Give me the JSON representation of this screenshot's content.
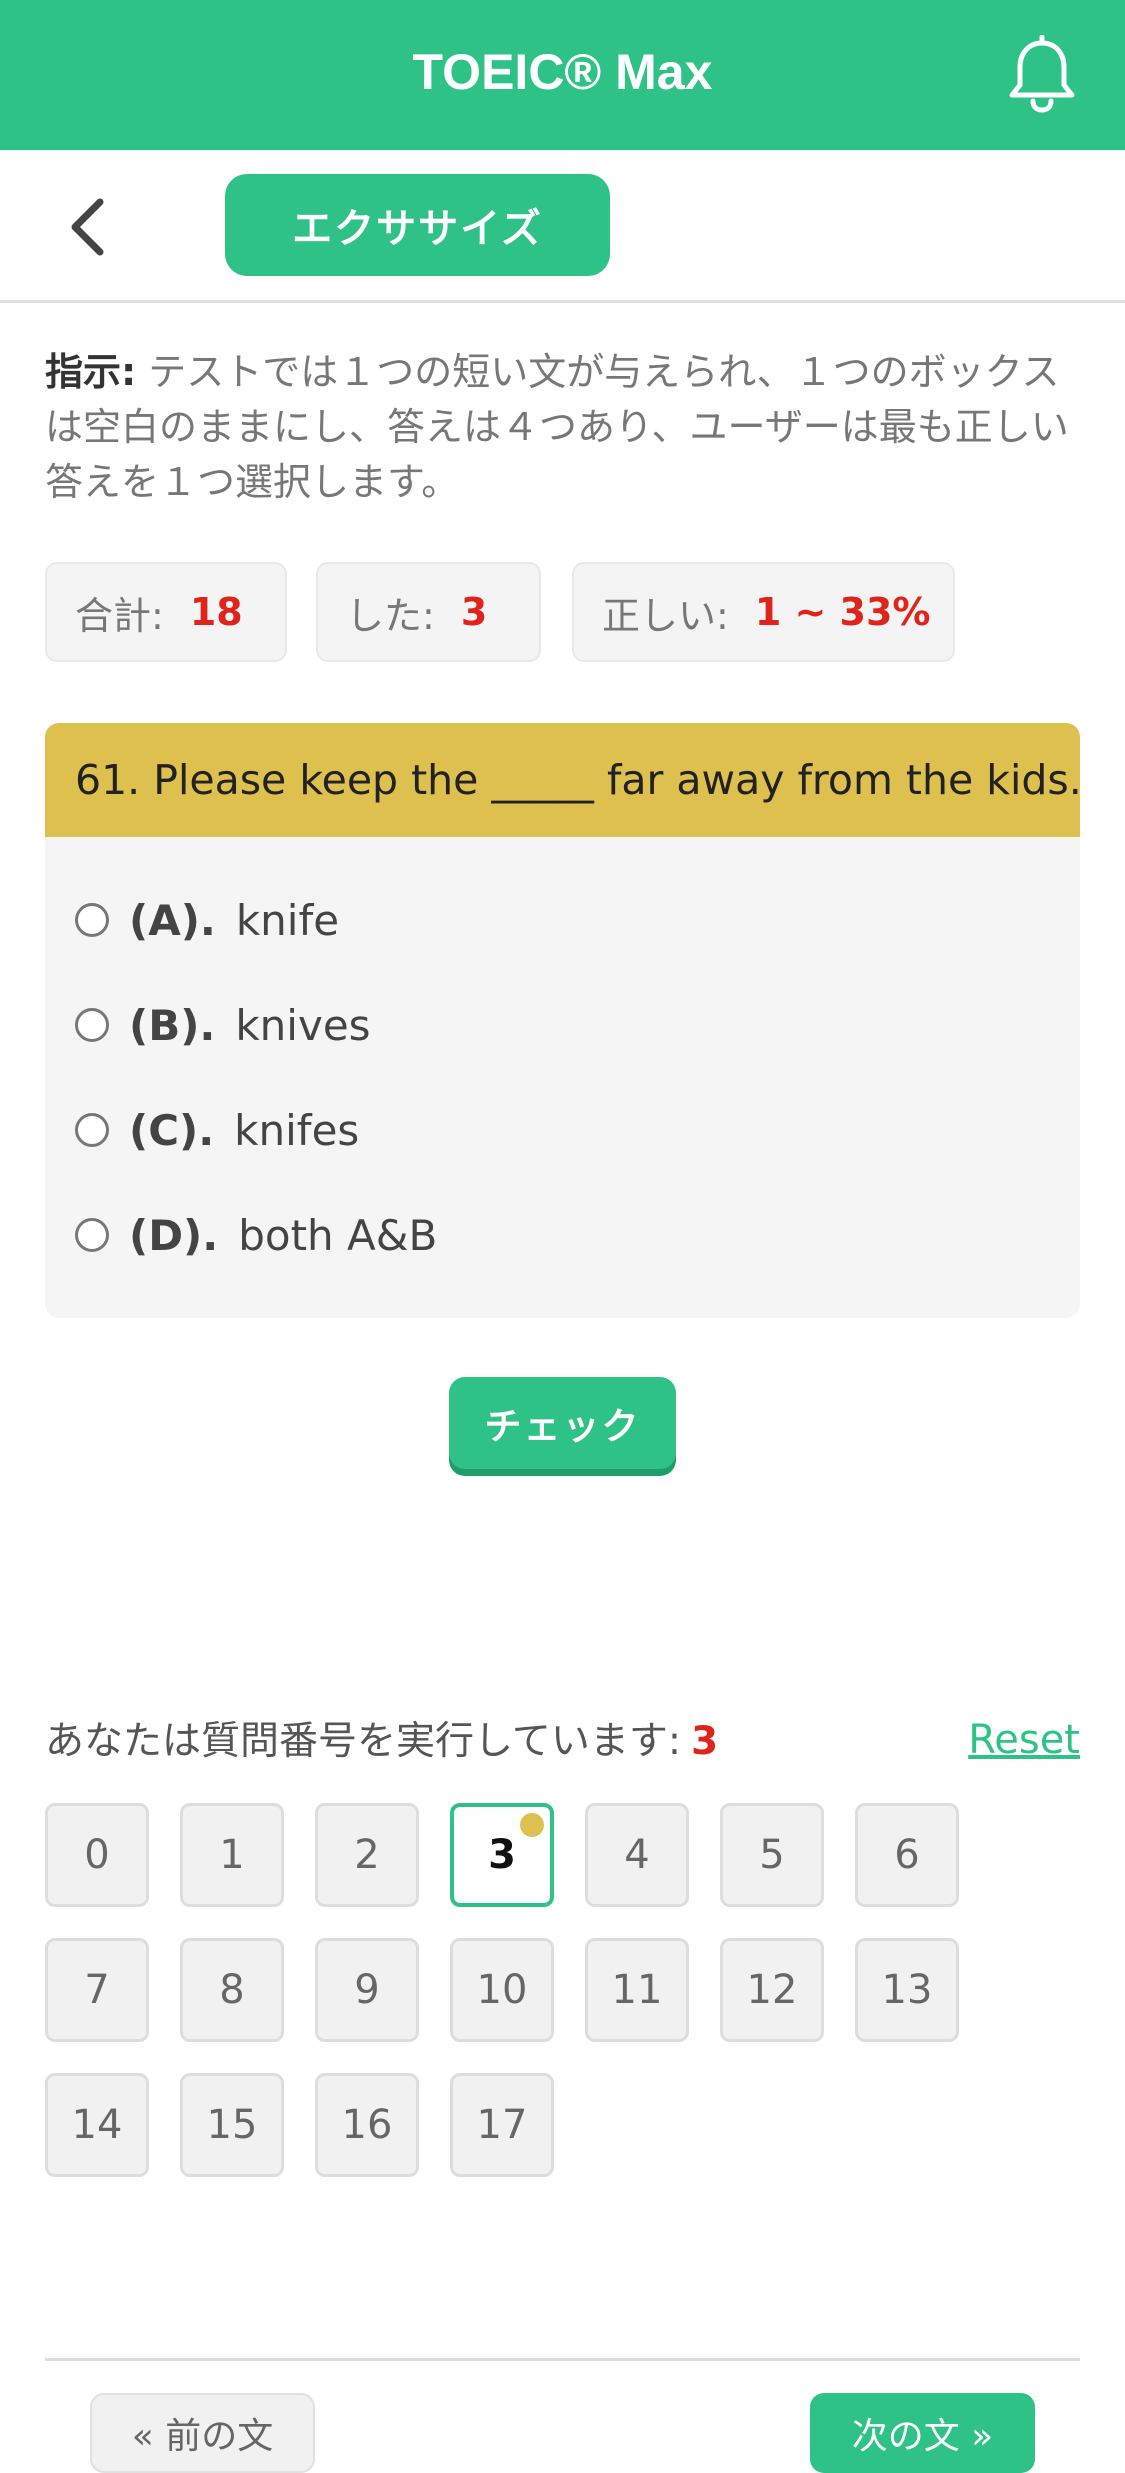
{
  "header": {
    "title": "TOEIC® Max",
    "bell_icon": "bell-icon"
  },
  "subbar": {
    "back_icon": "chevron-left-icon",
    "tab_label": "エクササイズ"
  },
  "instruction": {
    "label": "指示:",
    "text": " テストでは１つの短い文が与えられ、１つのボックスは空白のままにし、答えは４つあり、ユーザーは最も正しい答えを１つ選択します。"
  },
  "stats": {
    "total_label": "合計:",
    "total_value": "18",
    "done_label": "した:",
    "done_value": "3",
    "correct_label": "正しい:",
    "correct_value": "1 ~ 33%"
  },
  "question": {
    "text": "61. Please keep the _____ far away from the kids.",
    "options": [
      {
        "key": "(A).",
        "text": "knife"
      },
      {
        "key": "(B).",
        "text": "knives"
      },
      {
        "key": "(C).",
        "text": "knifes"
      },
      {
        "key": "(D).",
        "text": "both A&B"
      }
    ]
  },
  "check_button": "チェック",
  "progress": {
    "label": "あなたは質問番号を実行しています:",
    "current": "3",
    "reset": "Reset"
  },
  "numbers": [
    "0",
    "1",
    "2",
    "3",
    "4",
    "5",
    "6",
    "7",
    "8",
    "9",
    "10",
    "11",
    "12",
    "13",
    "14",
    "15",
    "16",
    "17"
  ],
  "active_number": 3,
  "nav": {
    "prev": "« 前の文",
    "next": "次の文 »"
  },
  "colors": {
    "accent": "#2EC286",
    "question_header": "#DDC04E",
    "highlight": "#e0241b"
  }
}
